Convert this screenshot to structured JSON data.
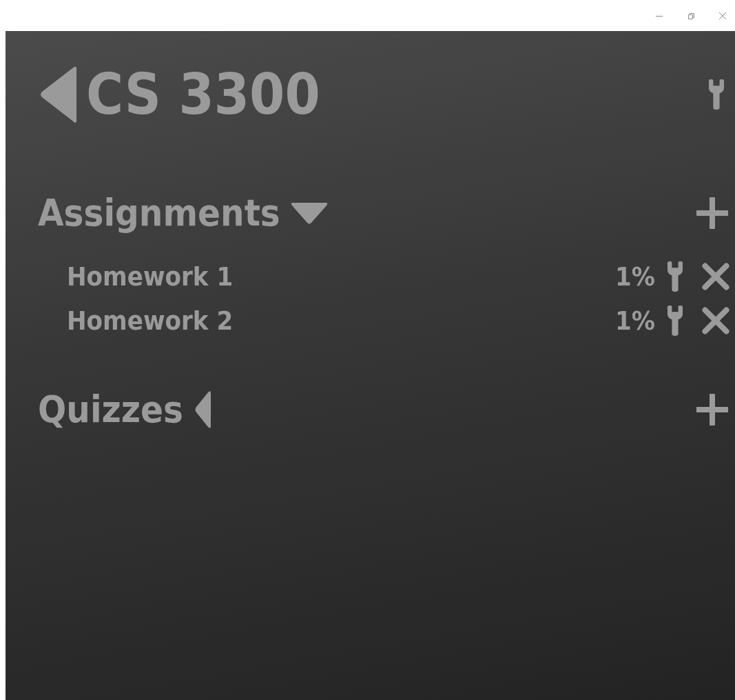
{
  "course": {
    "title": "CS 3300"
  },
  "categories": [
    {
      "name": "Assignments",
      "expanded": true,
      "items": [
        {
          "name": "Homework 1",
          "weight": "1%"
        },
        {
          "name": "Homework 2",
          "weight": "1%"
        }
      ]
    },
    {
      "name": "Quizzes",
      "expanded": false
    }
  ]
}
